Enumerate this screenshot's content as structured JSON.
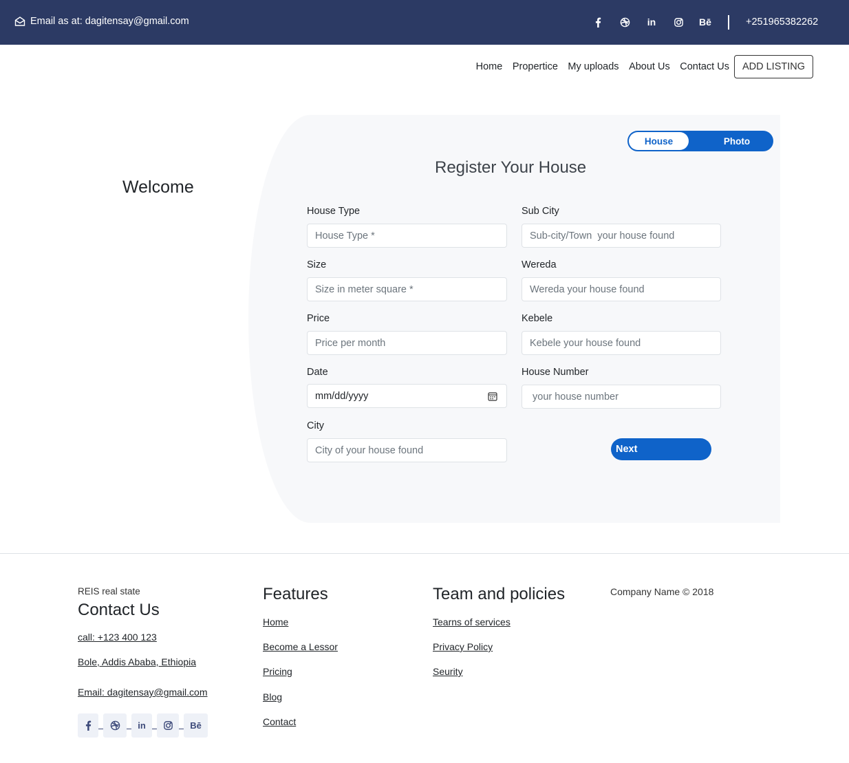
{
  "topbar": {
    "email_text": "Email as at: dagitensay@gmail.com",
    "phone": "+251965382262",
    "social_icons": [
      "facebook-icon",
      "dribbble-icon",
      "linkedin-icon",
      "instagram-icon",
      "behance-icon"
    ],
    "linkedin_glyph": "in",
    "behance_glyph": "Bē"
  },
  "nav": {
    "items": [
      "Home",
      "Propertice",
      "My uploads",
      "About Us",
      "Contact Us"
    ],
    "cta": "ADD LISTING"
  },
  "welcome": "Welcome",
  "form": {
    "toggle": {
      "house": "House",
      "photo": "Photo",
      "active": "House"
    },
    "title": "Register Your House",
    "fields": {
      "house_type": {
        "label": "House Type",
        "placeholder": "House Type *"
      },
      "sub_city": {
        "label": "Sub City",
        "placeholder": "Sub-city/Town  your house found"
      },
      "size": {
        "label": "Size",
        "placeholder": "Size in meter square *"
      },
      "wereda": {
        "label": "Wereda",
        "placeholder": "Wereda your house found"
      },
      "price": {
        "label": "Price",
        "placeholder": "Price per month"
      },
      "kebele": {
        "label": "Kebele",
        "placeholder": "Kebele your house found"
      },
      "date": {
        "label": "Date",
        "placeholder": "mm/dd/yyyy"
      },
      "house_number": {
        "label": "House Number",
        "placeholder": "your house number"
      },
      "city": {
        "label": "City",
        "placeholder": "City of your house found"
      }
    },
    "next_label": "Next"
  },
  "footer": {
    "brand": "REIS real state",
    "contact_heading": "Contact Us",
    "call": "call: +123 400 123",
    "address": "Bole, Addis Ababa, Ethiopia",
    "email": "Email: dagitensay@gmail.com",
    "features_heading": "Features",
    "features": [
      "Home",
      "Become a Lessor",
      "Pricing",
      "Blog",
      "Contact"
    ],
    "team_heading": "Team and policies",
    "policies": [
      "Tearns of services",
      "Privacy Policy",
      "Seurity"
    ],
    "copyright": "Company Name © 2018"
  },
  "colors": {
    "topbar_bg": "#2c3a64",
    "accent": "#0f63c9",
    "card_bg": "#f7f8fa"
  }
}
